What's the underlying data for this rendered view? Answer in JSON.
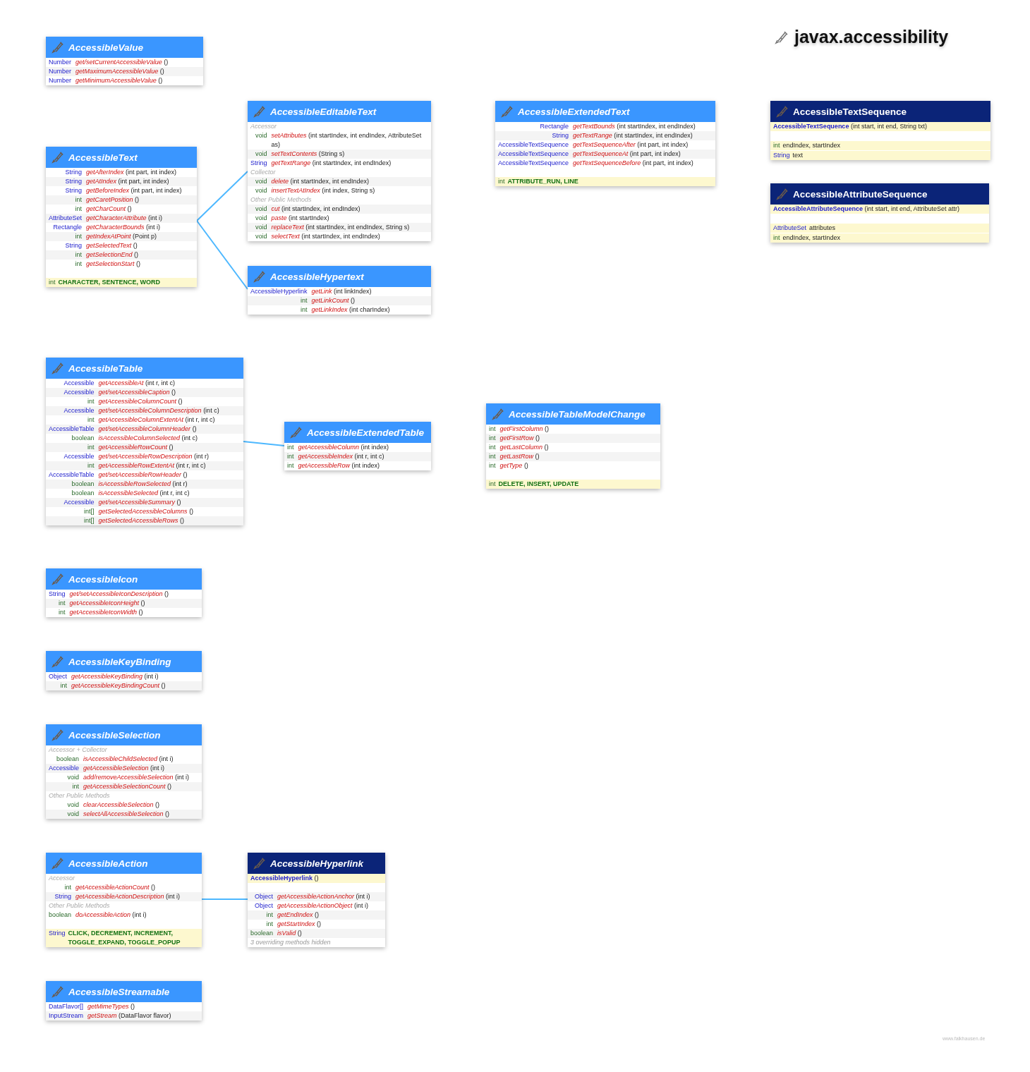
{
  "title": "javax.accessibility",
  "classes": [
    {
      "name": "AccessibleValue",
      "kind": "interface",
      "rows": [
        {
          "kind": "method",
          "type": "Number",
          "reference": true,
          "name": "get/setCurrentAccessibleValue",
          "params": "()"
        },
        {
          "kind": "method",
          "type": "Number",
          "reference": true,
          "name": "getMaximumAccessibleValue",
          "params": "()"
        },
        {
          "kind": "method",
          "type": "Number",
          "reference": true,
          "name": "getMinimumAccessibleValue",
          "params": "()"
        }
      ]
    },
    {
      "name": "AccessibleText",
      "kind": "interface",
      "rows": [
        {
          "kind": "method",
          "type": "String",
          "reference": true,
          "name": "getAfterIndex",
          "params": "(int part, int index)"
        },
        {
          "kind": "method",
          "type": "String",
          "reference": true,
          "name": "getAtIndex",
          "params": "(int part, int index)"
        },
        {
          "kind": "method",
          "type": "String",
          "reference": true,
          "name": "getBeforeIndex",
          "params": "(int part, int index)"
        },
        {
          "kind": "method",
          "type": "int",
          "reference": false,
          "name": "getCaretPosition",
          "params": "()"
        },
        {
          "kind": "method",
          "type": "int",
          "reference": false,
          "name": "getCharCount",
          "params": "()"
        },
        {
          "kind": "method",
          "type": "AttributeSet",
          "reference": true,
          "name": "getCharacterAttribute",
          "params": "(int i)"
        },
        {
          "kind": "method",
          "type": "Rectangle",
          "reference": true,
          "name": "getCharacterBounds",
          "params": "(int i)"
        },
        {
          "kind": "method",
          "type": "int",
          "reference": false,
          "name": "getIndexAtPoint",
          "params": "(Point p)"
        },
        {
          "kind": "method",
          "type": "String",
          "reference": true,
          "name": "getSelectedText",
          "params": "()"
        },
        {
          "kind": "method",
          "type": "int",
          "reference": false,
          "name": "getSelectionEnd",
          "params": "()"
        },
        {
          "kind": "method",
          "type": "int",
          "reference": false,
          "name": "getSelectionStart",
          "params": "()"
        },
        {
          "kind": "constant",
          "type": "int",
          "reference": false,
          "names": "CHARACTER, SENTENCE, WORD"
        }
      ]
    },
    {
      "name": "AccessibleEditableText",
      "kind": "interface",
      "rows": [
        {
          "kind": "section",
          "label": "Accessor"
        },
        {
          "kind": "method",
          "type": "void",
          "reference": false,
          "name": "setAttributes",
          "params": "(int startIndex, int endIndex, AttributeSet as)"
        },
        {
          "kind": "method",
          "type": "void",
          "reference": false,
          "name": "setTextContents",
          "params": "(String s)"
        },
        {
          "kind": "method",
          "type": "String",
          "reference": true,
          "name": "getTextRange",
          "params": "(int startIndex, int endIndex)"
        },
        {
          "kind": "section",
          "label": "Collector"
        },
        {
          "kind": "method",
          "type": "void",
          "reference": false,
          "name": "delete",
          "params": "(int startIndex, int endIndex)"
        },
        {
          "kind": "method",
          "type": "void",
          "reference": false,
          "name": "insertTextAtIndex",
          "params": "(int index, String s)"
        },
        {
          "kind": "section",
          "label": "Other Public Methods"
        },
        {
          "kind": "method",
          "type": "void",
          "reference": false,
          "name": "cut",
          "params": "(int startIndex, int endIndex)"
        },
        {
          "kind": "method",
          "type": "void",
          "reference": false,
          "name": "paste",
          "params": "(int startIndex)"
        },
        {
          "kind": "method",
          "type": "void",
          "reference": false,
          "name": "replaceText",
          "params": "(int startIndex, int endIndex, String s)"
        },
        {
          "kind": "method",
          "type": "void",
          "reference": false,
          "name": "selectText",
          "params": "(int startIndex, int endIndex)"
        }
      ]
    },
    {
      "name": "AccessibleHypertext",
      "kind": "interface",
      "rows": [
        {
          "kind": "method",
          "type": "AccessibleHyperlink",
          "reference": true,
          "name": "getLink",
          "params": "(int linkIndex)"
        },
        {
          "kind": "method",
          "type": "int",
          "reference": false,
          "name": "getLinkCount",
          "params": "()"
        },
        {
          "kind": "method",
          "type": "int",
          "reference": false,
          "name": "getLinkIndex",
          "params": "(int charIndex)"
        }
      ]
    },
    {
      "name": "AccessibleExtendedText",
      "kind": "interface",
      "rows": [
        {
          "kind": "method",
          "type": "Rectangle",
          "reference": true,
          "name": "getTextBounds",
          "params": "(int startIndex, int endIndex)"
        },
        {
          "kind": "method",
          "type": "String",
          "reference": true,
          "name": "getTextRange",
          "params": "(int startIndex, int endIndex)"
        },
        {
          "kind": "method",
          "type": "AccessibleTextSequence",
          "reference": true,
          "name": "getTextSequenceAfter",
          "params": "(int part, int index)"
        },
        {
          "kind": "method",
          "type": "AccessibleTextSequence",
          "reference": true,
          "name": "getTextSequenceAt",
          "params": "(int part, int index)"
        },
        {
          "kind": "method",
          "type": "AccessibleTextSequence",
          "reference": true,
          "name": "getTextSequenceBefore",
          "params": "(int part, int index)"
        },
        {
          "kind": "constant",
          "type": "int",
          "reference": false,
          "names": "ATTRIBUTE_RUN, LINE"
        }
      ]
    },
    {
      "name": "AccessibleTextSequence",
      "kind": "class",
      "rows": [
        {
          "kind": "constructor",
          "name": "AccessibleTextSequence",
          "params": "(int start, int end, String txt)"
        },
        {
          "kind": "field",
          "type": "int",
          "reference": false,
          "names": "endIndex, startIndex"
        },
        {
          "kind": "field",
          "type": "String",
          "reference": true,
          "names": "text"
        }
      ]
    },
    {
      "name": "AccessibleAttributeSequence",
      "kind": "class",
      "rows": [
        {
          "kind": "constructor",
          "name": "AccessibleAttributeSequence",
          "params": "(int start, int end, AttributeSet attr)"
        },
        {
          "kind": "field",
          "type": "AttributeSet",
          "reference": true,
          "names": "attributes"
        },
        {
          "kind": "field",
          "type": "int",
          "reference": false,
          "names": "endIndex, startIndex"
        }
      ]
    },
    {
      "name": "AccessibleTable",
      "kind": "interface",
      "rows": [
        {
          "kind": "method",
          "type": "Accessible",
          "reference": true,
          "name": "getAccessibleAt",
          "params": "(int r, int c)"
        },
        {
          "kind": "method",
          "type": "Accessible",
          "reference": true,
          "name": "get/setAccessibleCaption",
          "params": "()"
        },
        {
          "kind": "method",
          "type": "int",
          "reference": false,
          "name": "getAccessibleColumnCount",
          "params": "()"
        },
        {
          "kind": "method",
          "type": "Accessible",
          "reference": true,
          "name": "get/setAccessibleColumnDescription",
          "params": "(int c)"
        },
        {
          "kind": "method",
          "type": "int",
          "reference": false,
          "name": "getAccessibleColumnExtentAt",
          "params": "(int r, int c)"
        },
        {
          "kind": "method",
          "type": "AccessibleTable",
          "reference": true,
          "name": "get/setAccessibleColumnHeader",
          "params": "()"
        },
        {
          "kind": "method",
          "type": "boolean",
          "reference": false,
          "name": "isAccessibleColumnSelected",
          "params": "(int c)"
        },
        {
          "kind": "method",
          "type": "int",
          "reference": false,
          "name": "getAccessibleRowCount",
          "params": "()"
        },
        {
          "kind": "method",
          "type": "Accessible",
          "reference": true,
          "name": "get/setAccessibleRowDescription",
          "params": "(int r)"
        },
        {
          "kind": "method",
          "type": "int",
          "reference": false,
          "name": "getAccessibleRowExtentAt",
          "params": "(int r, int c)"
        },
        {
          "kind": "method",
          "type": "AccessibleTable",
          "reference": true,
          "name": "get/setAccessibleRowHeader",
          "params": "()"
        },
        {
          "kind": "method",
          "type": "boolean",
          "reference": false,
          "name": "isAccessibleRowSelected",
          "params": "(int r)"
        },
        {
          "kind": "method",
          "type": "boolean",
          "reference": false,
          "name": "isAccessibleSelected",
          "params": "(int r, int c)"
        },
        {
          "kind": "method",
          "type": "Accessible",
          "reference": true,
          "name": "get/setAccessibleSummary",
          "params": "()"
        },
        {
          "kind": "method",
          "type": "int[]",
          "reference": false,
          "name": "getSelectedAccessibleColumns",
          "params": "()"
        },
        {
          "kind": "method",
          "type": "int[]",
          "reference": false,
          "name": "getSelectedAccessibleRows",
          "params": "()"
        }
      ]
    },
    {
      "name": "AccessibleExtendedTable",
      "kind": "interface",
      "rows": [
        {
          "kind": "method",
          "type": "int",
          "reference": false,
          "name": "getAccessibleColumn",
          "params": "(int index)"
        },
        {
          "kind": "method",
          "type": "int",
          "reference": false,
          "name": "getAccessibleIndex",
          "params": "(int r, int c)"
        },
        {
          "kind": "method",
          "type": "int",
          "reference": false,
          "name": "getAccessibleRow",
          "params": "(int index)"
        }
      ]
    },
    {
      "name": "AccessibleTableModelChange",
      "kind": "interface",
      "rows": [
        {
          "kind": "method",
          "type": "int",
          "reference": false,
          "name": "getFirstColumn",
          "params": "()"
        },
        {
          "kind": "method",
          "type": "int",
          "reference": false,
          "name": "getFirstRow",
          "params": "()"
        },
        {
          "kind": "method",
          "type": "int",
          "reference": false,
          "name": "getLastColumn",
          "params": "()"
        },
        {
          "kind": "method",
          "type": "int",
          "reference": false,
          "name": "getLastRow",
          "params": "()"
        },
        {
          "kind": "method",
          "type": "int",
          "reference": false,
          "name": "getType",
          "params": "()"
        },
        {
          "kind": "constant",
          "type": "int",
          "reference": false,
          "names": "DELETE, INSERT, UPDATE"
        }
      ]
    },
    {
      "name": "AccessibleIcon",
      "kind": "interface",
      "rows": [
        {
          "kind": "method",
          "type": "String",
          "reference": true,
          "name": "get/setAccessibleIconDescription",
          "params": "()"
        },
        {
          "kind": "method",
          "type": "int",
          "reference": false,
          "name": "getAccessibleIconHeight",
          "params": "()"
        },
        {
          "kind": "method",
          "type": "int",
          "reference": false,
          "name": "getAccessibleIconWidth",
          "params": "()"
        }
      ]
    },
    {
      "name": "AccessibleKeyBinding",
      "kind": "interface",
      "rows": [
        {
          "kind": "method",
          "type": "Object",
          "reference": true,
          "name": "getAccessibleKeyBinding",
          "params": "(int i)"
        },
        {
          "kind": "method",
          "type": "int",
          "reference": false,
          "name": "getAccessibleKeyBindingCount",
          "params": "()"
        }
      ]
    },
    {
      "name": "AccessibleSelection",
      "kind": "interface",
      "rows": [
        {
          "kind": "section",
          "label": "Accessor + Collector"
        },
        {
          "kind": "method",
          "type": "boolean",
          "reference": false,
          "name": "isAccessibleChildSelected",
          "params": "(int i)"
        },
        {
          "kind": "method",
          "type": "Accessible",
          "reference": true,
          "name": "getAccessibleSelection",
          "params": "(int i)"
        },
        {
          "kind": "method",
          "type": "void",
          "reference": false,
          "name": "add/removeAccessibleSelection",
          "params": "(int i)"
        },
        {
          "kind": "method",
          "type": "int",
          "reference": false,
          "name": "getAccessibleSelectionCount",
          "params": "()"
        },
        {
          "kind": "section",
          "label": "Other Public Methods"
        },
        {
          "kind": "method",
          "type": "void",
          "reference": false,
          "name": "clearAccessibleSelection",
          "params": "()"
        },
        {
          "kind": "method",
          "type": "void",
          "reference": false,
          "name": "selectAllAccessibleSelection",
          "params": "()"
        }
      ]
    },
    {
      "name": "AccessibleAction",
      "kind": "interface",
      "rows": [
        {
          "kind": "section",
          "label": "Accessor"
        },
        {
          "kind": "method",
          "type": "int",
          "reference": false,
          "name": "getAccessibleActionCount",
          "params": "()"
        },
        {
          "kind": "method",
          "type": "String",
          "reference": true,
          "name": "getAccessibleActionDescription",
          "params": "(int i)"
        },
        {
          "kind": "section",
          "label": "Other Public Methods"
        },
        {
          "kind": "method",
          "type": "boolean",
          "reference": false,
          "name": "doAccessibleAction",
          "params": "(int i)"
        },
        {
          "kind": "constant",
          "type": "String",
          "reference": true,
          "names": "CLICK, DECREMENT, INCREMENT, TOGGLE_EXPAND, TOGGLE_POPUP"
        }
      ]
    },
    {
      "name": "AccessibleHyperlink",
      "kind": "abstract_class",
      "rows": [
        {
          "kind": "constructor",
          "name": "AccessibleHyperlink",
          "params": "()"
        },
        {
          "kind": "method",
          "type": "Object",
          "reference": true,
          "name": "getAccessibleActionAnchor",
          "params": "(int i)"
        },
        {
          "kind": "method",
          "type": "Object",
          "reference": true,
          "name": "getAccessibleActionObject",
          "params": "(int i)"
        },
        {
          "kind": "method",
          "type": "int",
          "reference": false,
          "name": "getEndIndex",
          "params": "()"
        },
        {
          "kind": "method",
          "type": "int",
          "reference": false,
          "name": "getStartIndex",
          "params": "()"
        },
        {
          "kind": "method",
          "type": "boolean",
          "reference": false,
          "name": "isValid",
          "params": "()"
        },
        {
          "kind": "note",
          "text": "3 overriding methods hidden"
        }
      ]
    },
    {
      "name": "AccessibleStreamable",
      "kind": "interface",
      "rows": [
        {
          "kind": "method",
          "type": "DataFlavor[]",
          "reference": true,
          "name": "getMimeTypes",
          "params": "()"
        },
        {
          "kind": "method",
          "type": "InputStream",
          "reference": true,
          "name": "getStream",
          "params": "(DataFlavor flavor)"
        }
      ]
    }
  ],
  "footer": "www.falkhausen.de"
}
